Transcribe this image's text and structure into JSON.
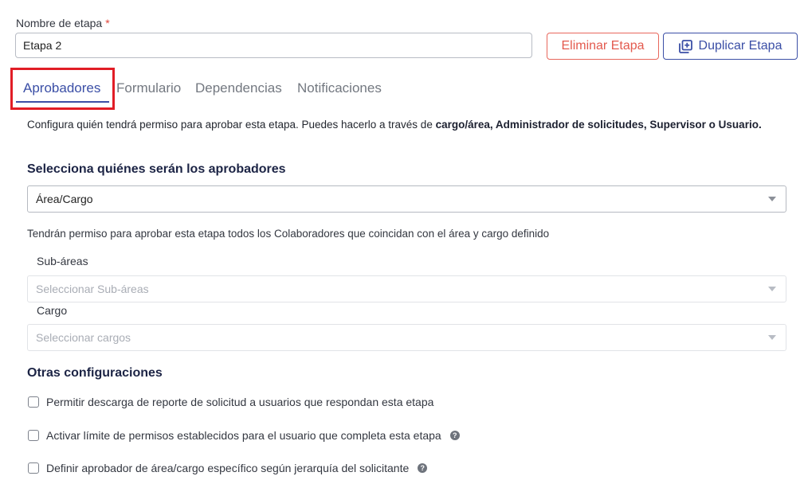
{
  "stage": {
    "label": "Nombre de etapa",
    "required_mark": "*",
    "value": "Etapa 2",
    "delete_button": "Eliminar Etapa",
    "duplicate_button": "Duplicar Etapa"
  },
  "tabs": [
    {
      "label": "Aprobadores",
      "active": true
    },
    {
      "label": "Formulario",
      "active": false
    },
    {
      "label": "Dependencias",
      "active": false
    },
    {
      "label": "Notificaciones",
      "active": false
    }
  ],
  "approvers": {
    "description_prefix": "Configura quién tendrá permiso para aprobar esta etapa. Puedes hacerlo a través de ",
    "description_bold_1": "cargo/área, Administrador de solicitudes, Supervisor o Usuario.",
    "heading": "Selecciona quiénes serán los aprobadores",
    "type_select_value": "Área/Cargo",
    "info": "Tendrán permiso para aprobar esta etapa todos los Colaboradores que coincidan con el área y cargo definido",
    "subareas_label": "Sub-áreas",
    "subareas_placeholder": "Seleccionar Sub-áreas",
    "cargo_label": "Cargo",
    "cargo_placeholder": "Seleccionar cargos"
  },
  "other": {
    "heading": "Otras configuraciones",
    "options": [
      {
        "label": "Permitir descarga de reporte de solicitud a usuarios que respondan esta etapa",
        "checked": false,
        "help": false
      },
      {
        "label": "Activar límite de permisos establecidos para el usuario que completa esta etapa",
        "checked": false,
        "help": true
      },
      {
        "label": "Definir aprobador de área/cargo específico según jerarquía del solicitante",
        "checked": false,
        "help": true
      }
    ],
    "help_glyph": "?"
  },
  "colors": {
    "accent": "#3b4fa6",
    "danger": "#e35a4e",
    "highlight": "#e11d26"
  },
  "icons": {
    "duplicate": "duplicate-icon",
    "dropdown": "chevron-down-icon",
    "help": "question-circle-icon"
  }
}
